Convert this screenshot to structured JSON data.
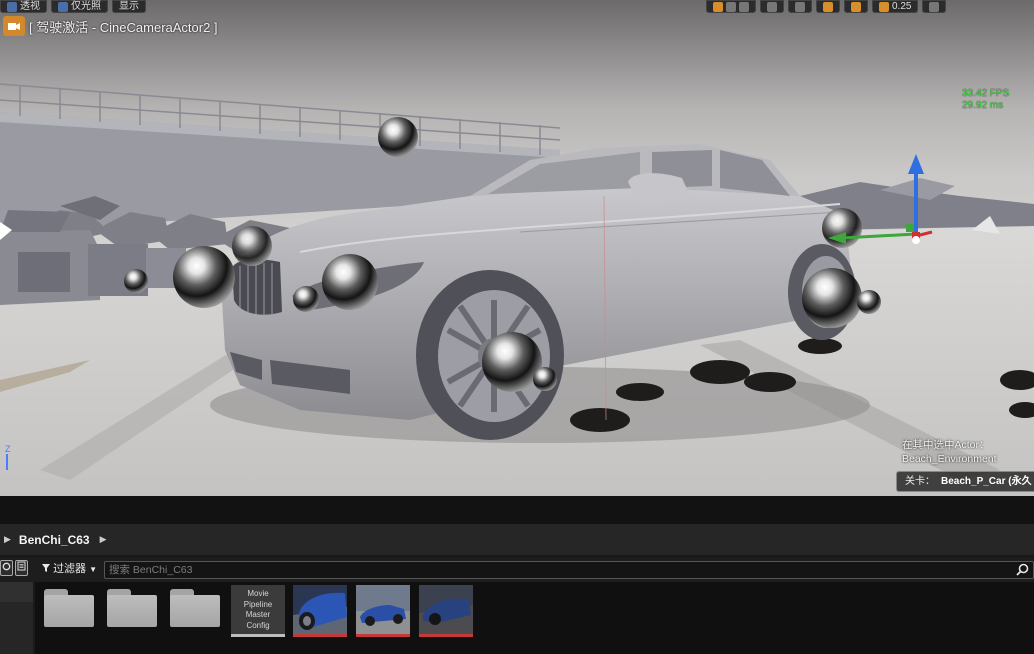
{
  "viewport": {
    "toolbar_left": {
      "btn_perspective": "透视",
      "btn_lit": "仅光照",
      "btn_show": "显示"
    },
    "toolbar_right": {
      "camera_speed": "0.25"
    },
    "pilot": {
      "label": "[ 驾驶激活 - CineCameraActor2 ]"
    },
    "stats": {
      "fps": "33.42 FPS",
      "ms": "29.92 ms"
    },
    "selection": {
      "line1": "在其中选中Actor：",
      "line2": "Beach_Environment"
    },
    "level": {
      "label": "关卡：",
      "name": "Beach_P_Car (永久"
    },
    "axis_label": "Z"
  },
  "content_browser": {
    "breadcrumb": "BenChi_C63",
    "filter_label": "过滤器",
    "search_placeholder": "搜索 BenChi_C63",
    "assets": [
      {
        "type": "folder"
      },
      {
        "type": "folder"
      },
      {
        "type": "folder"
      },
      {
        "type": "config",
        "label_lines": [
          "Movie",
          "Pipeline",
          "Master",
          "Config"
        ]
      },
      {
        "type": "thumbnail"
      },
      {
        "type": "thumbnail"
      },
      {
        "type": "thumbnail"
      }
    ]
  },
  "colors": {
    "fps_green": "#3be33b",
    "accent_orange": "#d2882b",
    "thumb_underline_red": "#c53939",
    "axis_blue": "#2f6fe0",
    "axis_green": "#3da63d",
    "axis_red": "#d03030"
  },
  "icons": [
    "pilot-camera-icon",
    "search-icon",
    "filter-icon",
    "view-options-icon",
    "folder-icon"
  ]
}
